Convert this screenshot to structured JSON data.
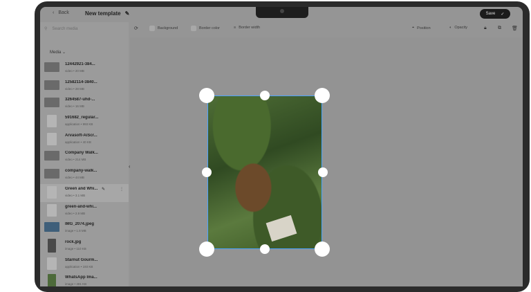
{
  "header": {
    "back_label": "Back",
    "title": "New template",
    "save_label": "Save"
  },
  "toolbar": {
    "background_label": "Background",
    "border_color_label": "Border color",
    "border_width_label": "Border width",
    "position_label": "Position",
    "opacity_label": "Opacity"
  },
  "sidebar": {
    "search_placeholder": "Search media",
    "tab_label": "Media",
    "items": [
      {
        "name": "12442921-384...",
        "meta": "video • 20 MB"
      },
      {
        "name": "12582114-3840...",
        "meta": "video • 28 MB"
      },
      {
        "name": "3264587-uhd-...",
        "meta": "video • 16 MB"
      },
      {
        "name": "591682_regular...",
        "meta": "application • 993 KB"
      },
      {
        "name": "Arvasoft-AiScr...",
        "meta": "application • 40 KB"
      },
      {
        "name": "Company Walk...",
        "meta": "video • 214 MB"
      },
      {
        "name": "company-walk...",
        "meta": "video • 44 MB"
      },
      {
        "name": "Green and Whi...",
        "meta": "video • 3.1 MB"
      },
      {
        "name": "green-and-whi...",
        "meta": "video • 2.9 MB"
      },
      {
        "name": "IMG_2074.jpeg",
        "meta": "image • 1.8 MB"
      },
      {
        "name": "rock.jpg",
        "meta": "image • 110 KB"
      },
      {
        "name": "Starnut Gourm...",
        "meta": "application • 193 KB"
      },
      {
        "name": "WhatsApp Ima...",
        "meta": "image • 491 KB"
      }
    ]
  }
}
